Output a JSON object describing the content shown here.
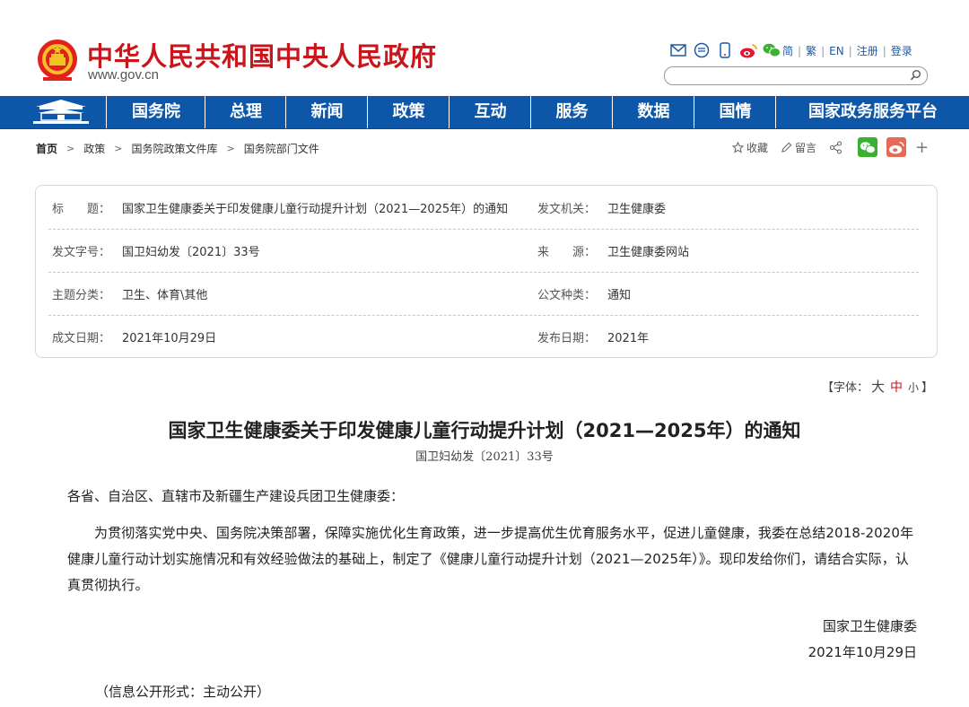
{
  "header": {
    "site_title": "中华人民共和国中央人民政府",
    "site_url": "www.gov.cn",
    "top_icons": [
      "mail-icon",
      "chat-bubble-icon",
      "mobile-phone-icon",
      "weibo-icon",
      "wechat-icon"
    ],
    "top_links": [
      "简",
      "繁",
      "EN",
      "注册",
      "登录"
    ],
    "search": {
      "placeholder": ""
    }
  },
  "nav": {
    "items": [
      "国务院",
      "总理",
      "新闻",
      "政策",
      "互动",
      "服务",
      "数据",
      "国情",
      "国家政务服务平台"
    ]
  },
  "breadcrumb": [
    "首页",
    "政策",
    "国务院政策文件库",
    "国务院部门文件"
  ],
  "share": {
    "favorite_label": "收藏",
    "comment_label": "留言",
    "more_symbol": "+"
  },
  "info": {
    "title_label": "标　　题：",
    "title_value": "国家卫生健康委关于印发健康儿童行动提升计划（2021—2025年）的通知",
    "issuer_label": "发文机关：",
    "issuer_value": "卫生健康委",
    "docno_label": "发文字号：",
    "docno_value": "国卫妇幼发〔2021〕33号",
    "source_label": "来　　源：",
    "source_value": "卫生健康委网站",
    "topic_label": "主题分类：",
    "topic_value": "卫生、体育\\其他",
    "type_label": "公文种类：",
    "type_value": "通知",
    "written_label": "成文日期：",
    "written_value": "2021年10月29日",
    "published_label": "发布日期：",
    "published_value": "2021年"
  },
  "fontsize": {
    "prefix": "【字体：",
    "big": "大",
    "medium": "中",
    "small": "小",
    "suffix": "】"
  },
  "article": {
    "title": "国家卫生健康委关于印发健康儿童行动提升计划（2021—2025年）的通知",
    "doc_number": "国卫妇幼发〔2021〕33号",
    "salutation": "各省、自治区、直辖市及新疆生产建设兵团卫生健康委：",
    "body": "为贯彻落实党中央、国务院决策部署，保障实施优化生育政策，进一步提高优生优育服务水平，促进儿童健康，我委在总结2018-2020年健康儿童行动计划实施情况和有效经验做法的基础上，制定了《健康儿童行动提升计划（2021—2025年）》。现印发给你们，请结合实际，认真贯彻执行。",
    "sign_org": "国家卫生健康委",
    "sign_date": "2021年10月29日",
    "disclosure": "（信息公开形式：主动公开）"
  },
  "colors": {
    "brand_red": "#c8161d",
    "nav_blue": "#0d56a8",
    "link_blue": "#1f5aa6",
    "wechat_green": "#3cb034",
    "weibo_red": "#e66a55"
  }
}
